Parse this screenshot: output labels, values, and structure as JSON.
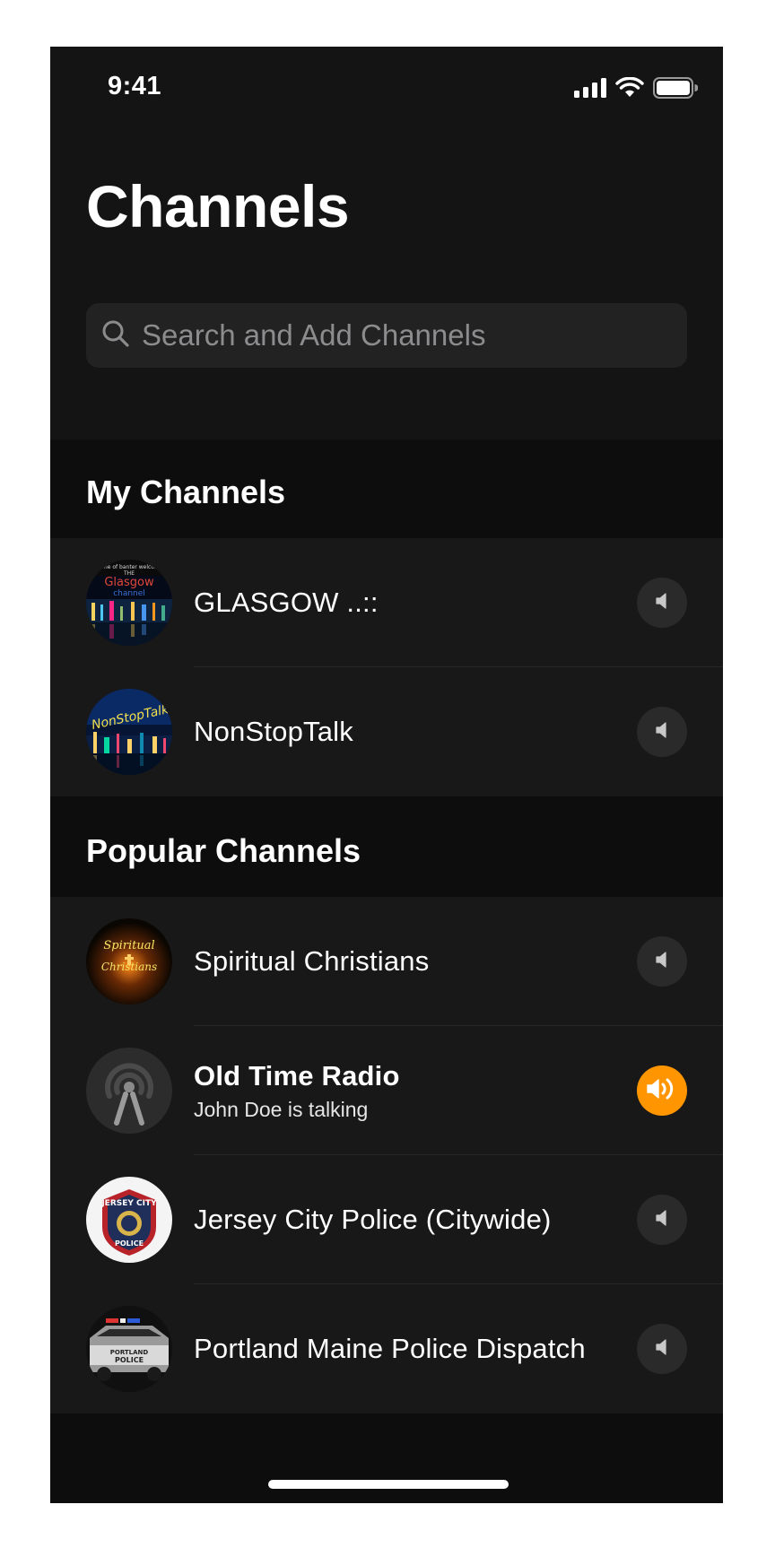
{
  "status_bar": {
    "time": "9:41"
  },
  "header": {
    "title": "Channels"
  },
  "search": {
    "placeholder": "Search and Add Channels"
  },
  "sections": {
    "my_channels": {
      "title": "My Channels",
      "items": [
        {
          "name": "GLASGOW ..::",
          "active": false,
          "avatar_lettering": "home of banter welcome THE Glasgow channel"
        },
        {
          "name": "NonStopTalk",
          "active": false,
          "avatar_lettering": "NonStopTalk"
        }
      ]
    },
    "popular_channels": {
      "title": "Popular Channels",
      "items": [
        {
          "name": "Spiritual Christians",
          "active": false,
          "avatar_lettering": "Spiritual Christians"
        },
        {
          "name": "Old Time Radio",
          "subtitle": "John Doe is talking",
          "active": true
        },
        {
          "name": "Jersey City Police (Citywide)",
          "active": false,
          "avatar_lettering": "JERSEY CITY POLICE"
        },
        {
          "name": "Portland Maine Police Dispatch",
          "active": false,
          "avatar_lettering": "PORTLAND POLICE"
        }
      ]
    }
  },
  "colors": {
    "accent": "#ff9500",
    "background": "#0d0d0d",
    "row_background": "#181818"
  },
  "icons": {
    "speaker_idle": "speaker-icon",
    "speaker_active": "speaker-waves-icon",
    "search": "magnifier-icon"
  }
}
